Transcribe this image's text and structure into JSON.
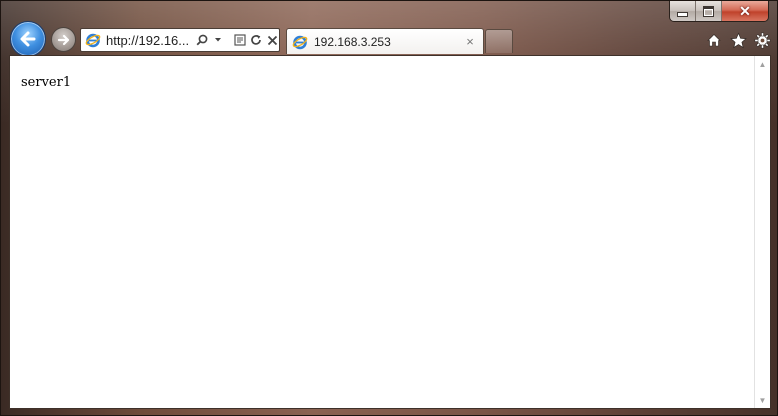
{
  "browser": {
    "address_text": "http://192.16...",
    "tabs": [
      {
        "title": "192.168.3.253",
        "close_label": "×",
        "active": true
      }
    ],
    "caption": {
      "close_label": "✕"
    },
    "icons": [
      "back-arrow-icon",
      "forward-arrow-icon",
      "ie-logo-icon",
      "search-icon",
      "dropdown-icon",
      "compatibility-view-icon",
      "refresh-icon",
      "stop-icon",
      "home-icon",
      "favorites-star-icon",
      "tools-gear-icon",
      "minimize-icon",
      "maximize-icon",
      "close-icon"
    ]
  },
  "page": {
    "body_text": "server1"
  },
  "colors": {
    "back_button": "#3f8fe0",
    "close_button": "#c0422b",
    "frame": "#7a5446"
  }
}
